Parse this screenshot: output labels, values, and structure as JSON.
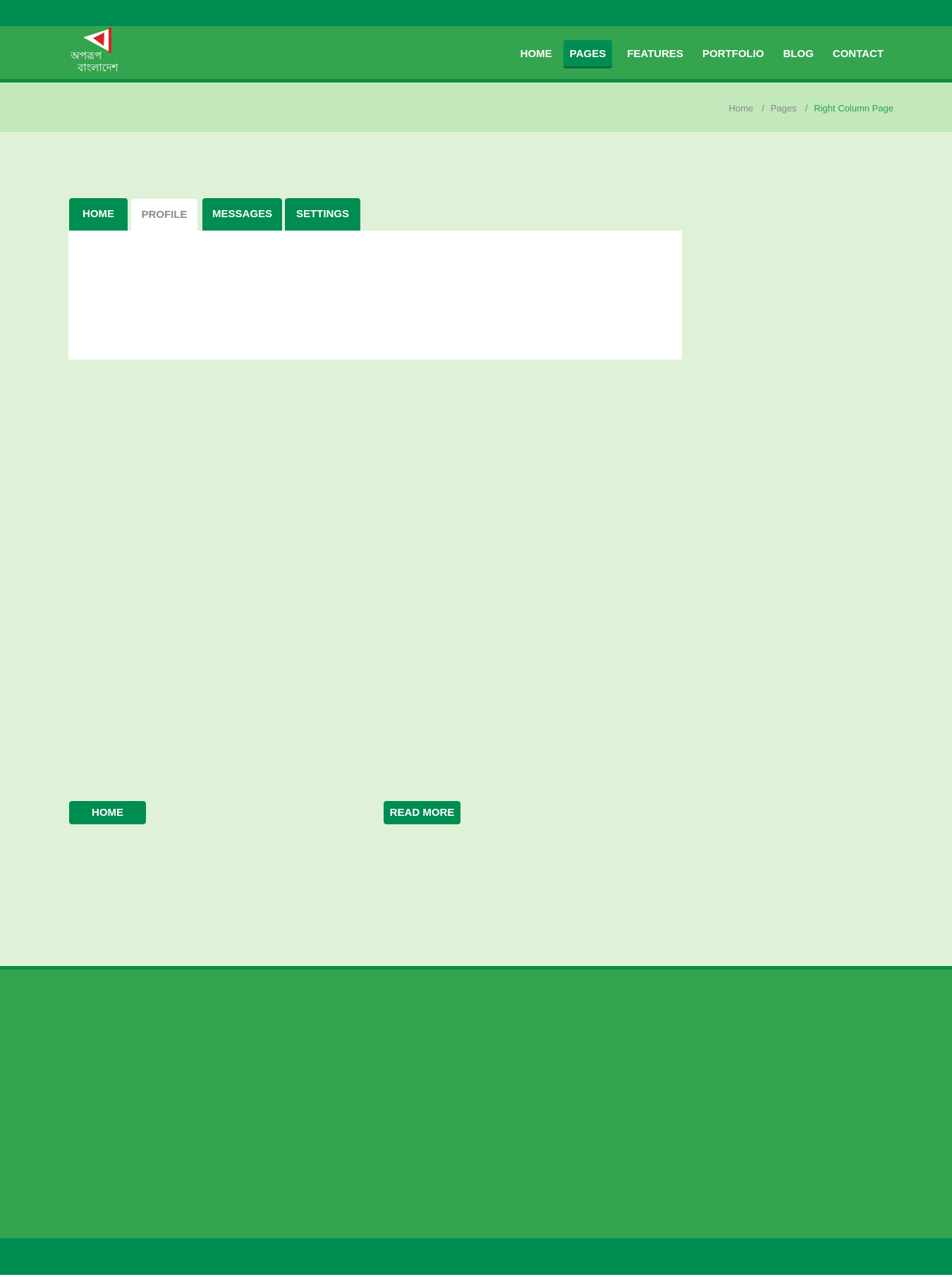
{
  "brand": {
    "logo_text_line1": "অপরূপ",
    "logo_text_line2": "বাংলাদেশ",
    "colors": {
      "dark_green": "#008d52",
      "green": "#34a44e",
      "light_green": "#c2e8bc",
      "pale_green": "#dff2d8",
      "flag_red": "#e0211f"
    }
  },
  "nav": {
    "items": [
      {
        "label": "HOME",
        "active": false
      },
      {
        "label": "PAGES",
        "active": true
      },
      {
        "label": "FEATURES",
        "active": false
      },
      {
        "label": "PORTFOLIO",
        "active": false
      },
      {
        "label": "BLOG",
        "active": false
      },
      {
        "label": "CONTACT",
        "active": false
      }
    ]
  },
  "breadcrumb": {
    "items": [
      "Home",
      "Pages"
    ],
    "separator": "/",
    "current": "Right Column Page"
  },
  "tabs": {
    "items": [
      {
        "label": "HOME",
        "active": false
      },
      {
        "label": "PROFILE",
        "active": true
      },
      {
        "label": "MESSAGES",
        "active": false
      },
      {
        "label": "SETTINGS",
        "active": false
      }
    ]
  },
  "buttons": {
    "home_label": "HOME",
    "read_more_label": "READ MORE"
  }
}
